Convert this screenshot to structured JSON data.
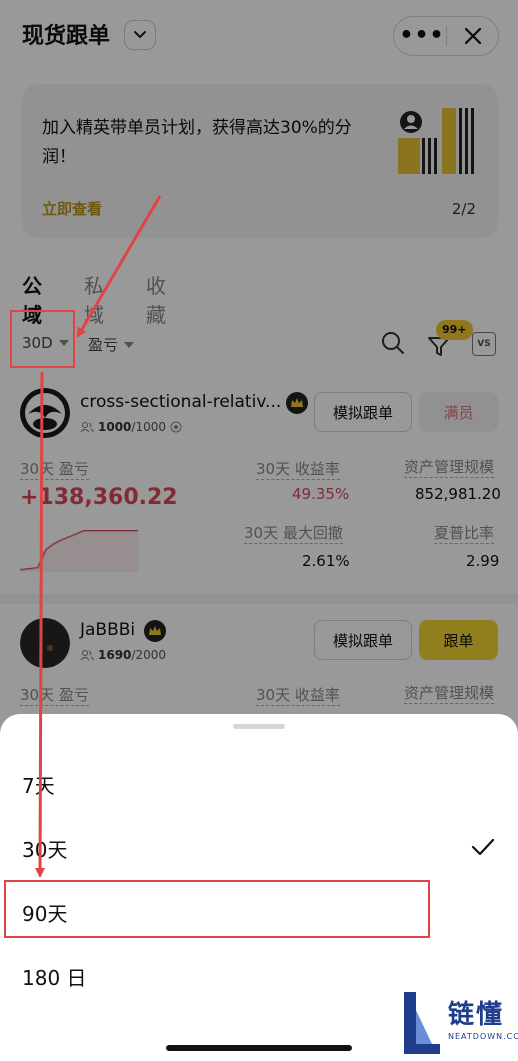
{
  "header": {
    "title": "现货跟单"
  },
  "banner": {
    "text": "加入精英带单员计划，获得高达30%的分润！",
    "link": "立即查看",
    "pagination": "2/2"
  },
  "tabs": [
    {
      "label": "公域",
      "active": true
    },
    {
      "label": "私域",
      "active": false
    },
    {
      "label": "收藏",
      "active": false
    }
  ],
  "filters": {
    "period": "30D",
    "sort": "盈亏",
    "badge": "99+",
    "vs": "VS"
  },
  "traders": [
    {
      "name": "cross-sectional-relativ...",
      "followers": "1000",
      "followers_max": "/1000",
      "btn_sim": "模拟跟单",
      "btn_action": "满员",
      "pnl_label": "30天 盈亏",
      "pnl_value": "+138,360.22",
      "roi_label": "30天 收益率",
      "roi_value": "49.35%",
      "aum_label": "资产管理规模",
      "aum_value": "852,981.20",
      "mdd_label": "30天 最大回撤",
      "mdd_value": "2.61%",
      "sharpe_label": "夏普比率",
      "sharpe_value": "2.99"
    },
    {
      "name": "JaBBBi",
      "followers": "1690",
      "followers_max": "/2000",
      "btn_sim": "模拟跟单",
      "btn_action": "跟单",
      "pnl_label": "30天 盈亏",
      "roi_label": "30天 收益率",
      "aum_label": "资产管理规模"
    }
  ],
  "sheet": {
    "options": [
      {
        "label": "7天",
        "selected": false
      },
      {
        "label": "30天",
        "selected": true
      },
      {
        "label": "90天",
        "selected": false
      },
      {
        "label": "180 日",
        "selected": false
      }
    ]
  },
  "watermark": {
    "text": "链懂",
    "sub": "NEATDOWN.COM"
  },
  "colors": {
    "accent_yellow": "#f2d230",
    "profit_red": "#d9475a",
    "annotation_red": "#e04545"
  }
}
